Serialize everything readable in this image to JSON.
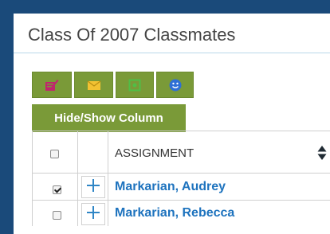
{
  "page": {
    "title": "Class Of 2007 Classmates"
  },
  "toolbar": {
    "hide_show_label": "Hide/Show Column",
    "buttons": [
      {
        "icon": "note-icon",
        "color": "#c0266e"
      },
      {
        "icon": "envelope-icon",
        "color": "#f2c232"
      },
      {
        "icon": "photo-icon",
        "color": "#4fbf46"
      },
      {
        "icon": "smiley-icon",
        "color": "#2f6fd6"
      }
    ]
  },
  "table": {
    "column_header": "ASSIGNMENT",
    "rows": [
      {
        "name": "Markarian, Audrey",
        "checked": true
      },
      {
        "name": "Markarian, Rebecca",
        "checked": false
      }
    ]
  },
  "colors": {
    "frame": "#1a4a7a",
    "button_green": "#7a9a38",
    "link_blue": "#1e73be"
  }
}
